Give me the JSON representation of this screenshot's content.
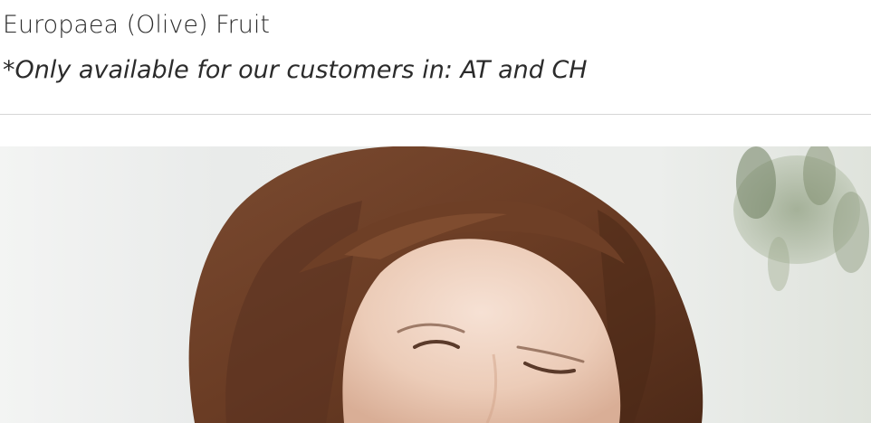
{
  "ingredient": {
    "name": "Europaea (Olive) Fruit",
    "availability_note": "*Only available for our customers in: AT and CH"
  },
  "colors": {
    "text": "#2b2b2b",
    "divider": "#d6d6d6",
    "background": "#ffffff"
  }
}
